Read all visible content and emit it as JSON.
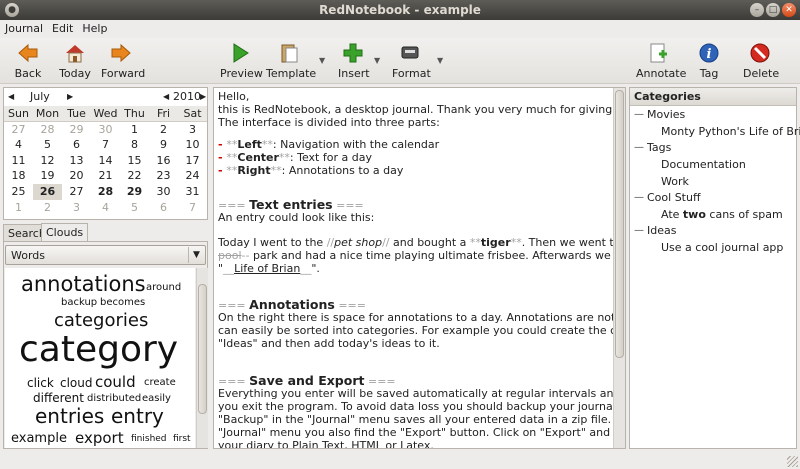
{
  "window": {
    "title": "RedNotebook - example"
  },
  "menu": [
    "Journal",
    "Edit",
    "Help"
  ],
  "toolbar": {
    "back": "Back",
    "today": "Today",
    "forward": "Forward",
    "preview": "Preview",
    "template": "Template",
    "insert": "Insert",
    "format": "Format",
    "annotate": "Annotate",
    "tag": "Tag",
    "delete": "Delete"
  },
  "calendar": {
    "month": "July",
    "year": "2010",
    "weekdays": [
      "Sun",
      "Mon",
      "Tue",
      "Wed",
      "Thu",
      "Fri",
      "Sat"
    ],
    "weeks": [
      [
        "27",
        "28",
        "29",
        "30",
        "1",
        "2",
        "3"
      ],
      [
        "4",
        "5",
        "6",
        "7",
        "8",
        "9",
        "10"
      ],
      [
        "11",
        "12",
        "13",
        "14",
        "15",
        "16",
        "17"
      ],
      [
        "18",
        "19",
        "20",
        "21",
        "22",
        "23",
        "24"
      ],
      [
        "25",
        "26",
        "27",
        "28",
        "29",
        "30",
        "31"
      ],
      [
        "1",
        "2",
        "3",
        "4",
        "5",
        "6",
        "7"
      ]
    ]
  },
  "tabs": {
    "search": "Search",
    "clouds": "Clouds"
  },
  "cloud": {
    "selector": "Words",
    "words": [
      "annotations",
      "around",
      "backup",
      "becomes",
      "categories",
      "category",
      "click",
      "cloud",
      "could",
      "create",
      "different",
      "distributed",
      "easily",
      "entries",
      "entry",
      "example",
      "export",
      "finished",
      "first"
    ]
  },
  "editor": {
    "l1": "Hello,",
    "l2": "this is RedNotebook, a desktop journal. Thank you very much for giving it a try.",
    "l3": "The interface is divided into three parts:",
    "b1_dash": "- ",
    "b1_m1": "**",
    "b1_key": "Left",
    "b1_m2": "**",
    "b1_rest": ": Navigation with the calendar",
    "b2_dash": "- ",
    "b2_m1": "**",
    "b2_key": "Center",
    "b2_m2": "**",
    "b2_rest": ": Text for a day",
    "b3_dash": "- ",
    "b3_m1": "**",
    "b3_key": "Right",
    "b3_m2": "**",
    "b3_rest": ": Annotations to a day",
    "h1_m1": "=== ",
    "h1": "Text entries",
    "h1_m2": " ===",
    "l4": "An entry could look like this:",
    "l5_a": "Today I went to the ",
    "l5_i1": "//",
    "l5_it": "pet shop",
    "l5_i2": "//",
    "l5_b": " and bought a ",
    "l5_s1": "**",
    "l5_bold": "tiger",
    "l5_s2": "**",
    "l5_c": ". Then we went to the ",
    "l5_st": "--",
    "l6_strike": "pool",
    "l6_st": "--",
    "l6_a": " park and had a nice time playing ultimate frisbee. Afterwards we watched",
    "l7_q1": "\"",
    "l7_u1": "__",
    "l7_u": "Life of Brian",
    "l7_u2": "__",
    "l7_q2": "\".",
    "h2_m1": "=== ",
    "h2": "Annotations",
    "h2_m2": " ===",
    "l8": "On the right there is space for annotations to a day. Annotations are notes that",
    "l9": "can easily be sorted into categories. For example you could create the category",
    "l10": "\"Ideas\" and then add today's ideas to it.",
    "h3_m1": "=== ",
    "h3": "Save and Export",
    "h3_m2": " ===",
    "l11": "Everything you enter will be saved automatically at regular intervals and when",
    "l12": "you exit the program. To avoid data loss you should backup your journal regularly.",
    "l13": "\"Backup\" in the \"Journal\" menu saves all your entered data in a zip file. In the",
    "l14": "\"Journal\" menu you also find the \"Export\" button. Click on \"Export\" and export",
    "l15": "your diary to Plain Text, HTML or Latex."
  },
  "categories": {
    "header": "Categories",
    "movies": "Movies",
    "movies_1": "Monty Python's Life of Brian",
    "tags": "Tags",
    "tags_1": "Documentation",
    "tags_2": "Work",
    "cool": "Cool Stuff",
    "cool_1a": "Ate ",
    "cool_1b": "two",
    "cool_1c": " cans of spam",
    "ideas": "Ideas",
    "ideas_1": "Use a cool journal app"
  },
  "icons": [
    "back-arrow-icon",
    "home-icon",
    "forward-arrow-icon",
    "play-icon",
    "clipboard-icon",
    "plus-icon",
    "format-icon",
    "note-icon",
    "info-icon",
    "delete-icon"
  ],
  "colors": {
    "accent_red": "#d10000",
    "toolbar_green": "#3aa12a"
  }
}
